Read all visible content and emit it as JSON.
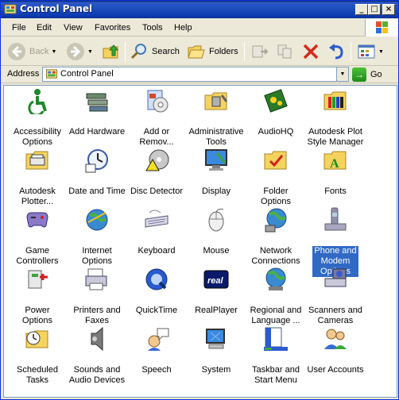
{
  "window": {
    "title": "Control Panel"
  },
  "menubar": {
    "items": [
      "File",
      "Edit",
      "View",
      "Favorites",
      "Tools",
      "Help"
    ]
  },
  "toolbar": {
    "back_label": "Back",
    "search_label": "Search",
    "folders_label": "Folders"
  },
  "address": {
    "label": "Address",
    "value": "Control Panel",
    "go_label": "Go"
  },
  "items": [
    {
      "label": "Accessibility\nOptions",
      "icon": "accessibility-icon"
    },
    {
      "label": "Add Hardware",
      "icon": "add-hardware-icon"
    },
    {
      "label": "Add or\nRemov...",
      "icon": "add-remove-programs-icon"
    },
    {
      "label": "Administrative\nTools",
      "icon": "administrative-tools-icon"
    },
    {
      "label": "AudioHQ",
      "icon": "audiohq-icon"
    },
    {
      "label": "Autodesk Plot\nStyle Manager",
      "icon": "autodesk-plot-style-icon"
    },
    {
      "label": "Autodesk\nPlotter...",
      "icon": "autodesk-plotter-icon"
    },
    {
      "label": "Date and Time",
      "icon": "date-time-icon"
    },
    {
      "label": "Disc Detector",
      "icon": "disc-detector-icon"
    },
    {
      "label": "Display",
      "icon": "display-icon"
    },
    {
      "label": "Folder Options",
      "icon": "folder-options-icon"
    },
    {
      "label": "Fonts",
      "icon": "fonts-icon"
    },
    {
      "label": "Game\nControllers",
      "icon": "game-controllers-icon"
    },
    {
      "label": "Internet\nOptions",
      "icon": "internet-options-icon"
    },
    {
      "label": "Keyboard",
      "icon": "keyboard-icon"
    },
    {
      "label": "Mouse",
      "icon": "mouse-icon"
    },
    {
      "label": "Network\nConnections",
      "icon": "network-connections-icon"
    },
    {
      "label": "Phone and\nModem\nOptions",
      "icon": "phone-modem-icon",
      "selected": true
    },
    {
      "label": "Power Options",
      "icon": "power-options-icon"
    },
    {
      "label": "Printers and\nFaxes",
      "icon": "printers-faxes-icon"
    },
    {
      "label": "QuickTime",
      "icon": "quicktime-icon"
    },
    {
      "label": "RealPlayer",
      "icon": "realplayer-icon"
    },
    {
      "label": "Regional and\nLanguage ...",
      "icon": "regional-language-icon"
    },
    {
      "label": "Scanners and\nCameras",
      "icon": "scanners-cameras-icon"
    },
    {
      "label": "Scheduled\nTasks",
      "icon": "scheduled-tasks-icon"
    },
    {
      "label": "Sounds and\nAudio Devices",
      "icon": "sounds-audio-icon"
    },
    {
      "label": "Speech",
      "icon": "speech-icon"
    },
    {
      "label": "System",
      "icon": "system-icon"
    },
    {
      "label": "Taskbar and\nStart Menu",
      "icon": "taskbar-start-menu-icon"
    },
    {
      "label": "User Accounts",
      "icon": "user-accounts-icon"
    }
  ],
  "colors": {
    "titlebar": "#0a246a",
    "selection": "#316ac5",
    "window_bg": "#ece9d8"
  }
}
